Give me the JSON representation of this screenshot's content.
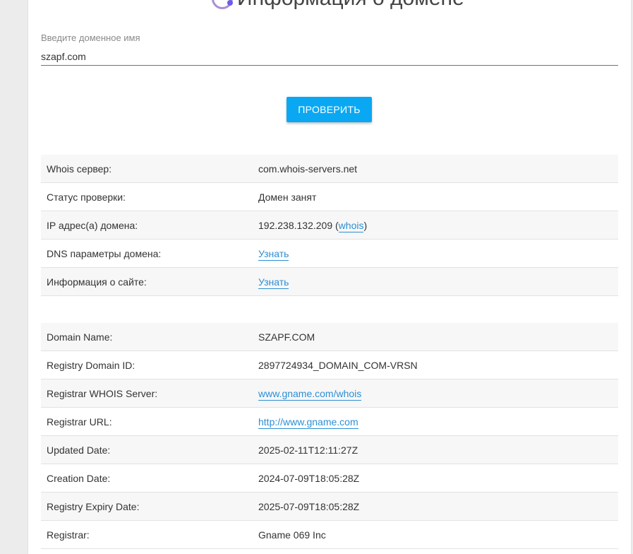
{
  "page": {
    "title": "Информация о домене",
    "accent_color": "#0aa8f2",
    "link_color": "#2b8fd4"
  },
  "form": {
    "label": "Введите доменное имя",
    "value": "szapf.com",
    "button_label": "ПРОВЕРИТЬ"
  },
  "summary": {
    "whois_server_label": "Whois сервер:",
    "whois_server_value": "com.whois-servers.net",
    "status_label": "Статус проверки:",
    "status_value": "Домен занят",
    "ip_label": "IP адрес(а) домена:",
    "ip_value": "192.238.132.209",
    "ip_open": " (",
    "ip_link": "whois",
    "ip_close": ")",
    "dns_label": "DNS параметры домена:",
    "dns_link": "Узнать",
    "site_label": "Информация о сайте:",
    "site_link": "Узнать"
  },
  "whois": {
    "domain_name_label": "Domain Name:",
    "domain_name_value": "SZAPF.COM",
    "registry_id_label": "Registry Domain ID:",
    "registry_id_value": "2897724934_DOMAIN_COM-VRSN",
    "registrar_whois_label": "Registrar WHOIS Server:",
    "registrar_whois_value": "www.gname.com/whois",
    "registrar_url_label": "Registrar URL:",
    "registrar_url_value": "http://www.gname.com",
    "updated_label": "Updated Date:",
    "updated_value": "2025-02-11T12:11:27Z",
    "creation_label": "Creation Date:",
    "creation_value": "2024-07-09T18:05:28Z",
    "expiry_label": "Registry Expiry Date:",
    "expiry_value": "2025-07-09T18:05:28Z",
    "registrar_label": "Registrar:",
    "registrar_value": "Gname 069 Inc"
  }
}
